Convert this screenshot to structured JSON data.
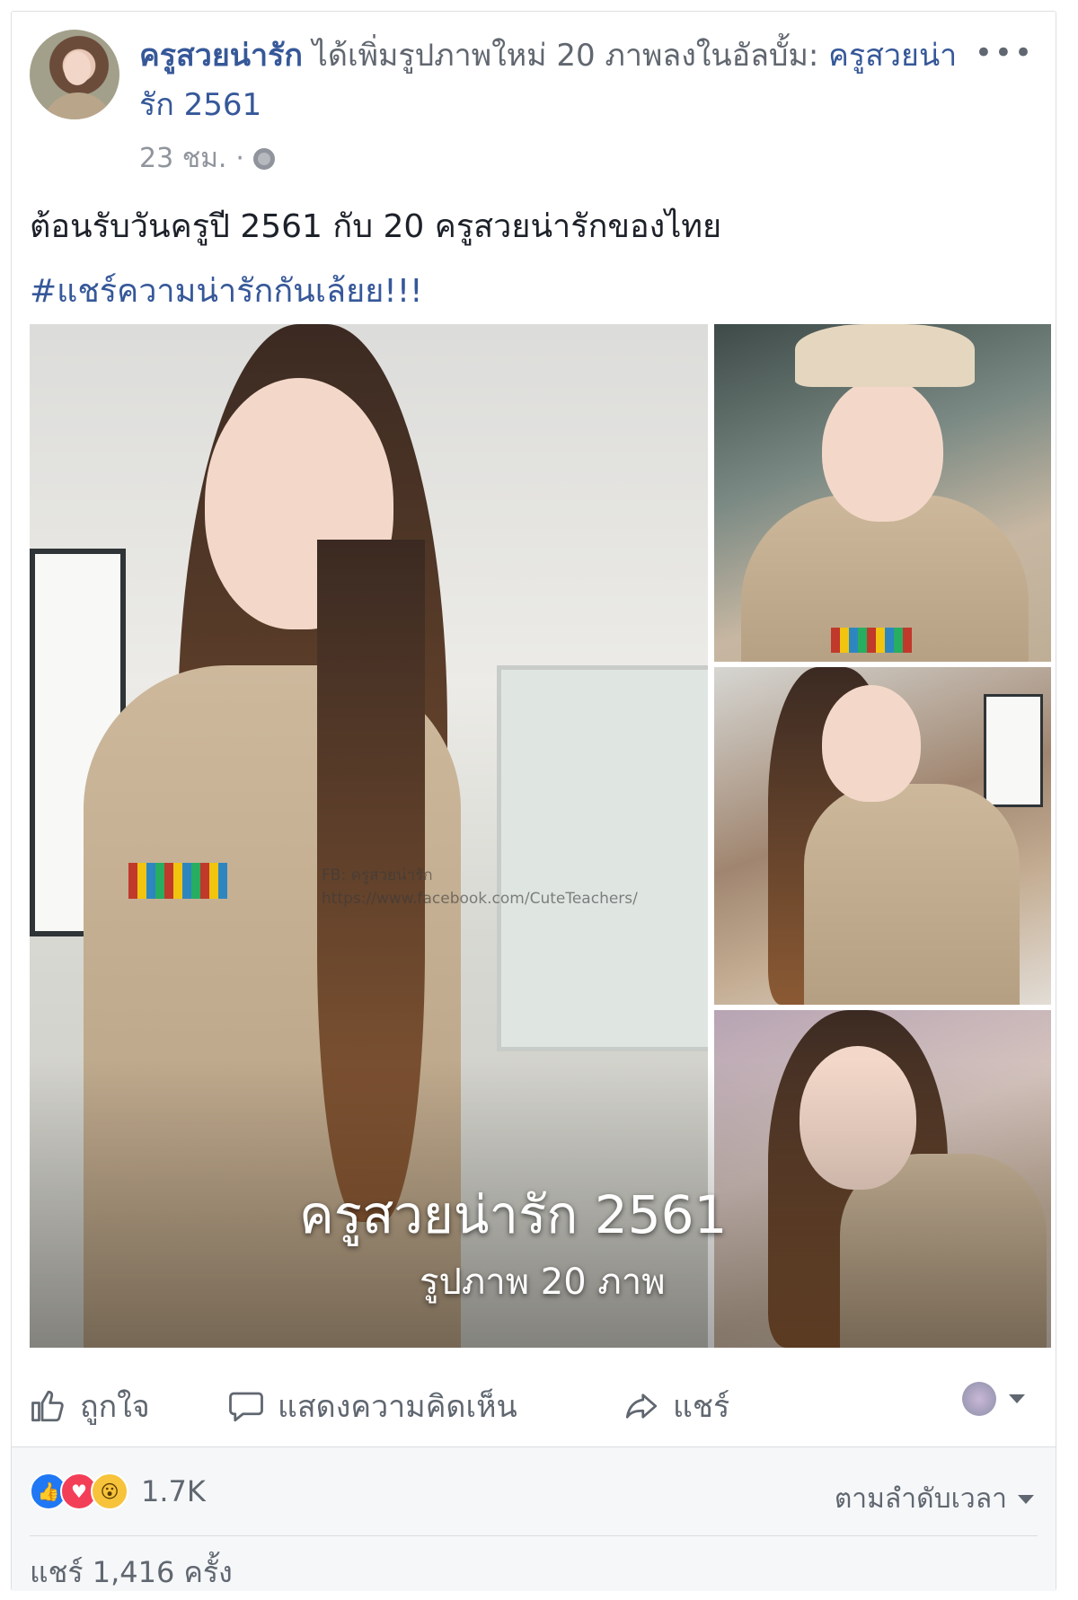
{
  "post": {
    "author": "ครูสวยน่ารัก",
    "action_text": "ได้เพิ่มรูปภาพใหม่ 20 ภาพลงในอัลบั้ม:",
    "album_name": "ครูสวยน่ารัก 2561",
    "timestamp": "23 ชม.",
    "separator": "·",
    "more_label": "•••",
    "text": "ต้อนรับวันครูปี 2561 กับ 20 ครูสวยน่ารักของไทย",
    "hashtag": "#แชร์ความน่ารักกันเล้ยย!!!"
  },
  "album_overlay": {
    "title": "ครูสวยน่ารัก 2561",
    "count": "รูปภาพ 20 ภาพ"
  },
  "watermark": {
    "line1": "FB: ครูสวยน่ารัก",
    "line2": "https://www.facebook.com/CuteTeachers/"
  },
  "actions": {
    "like": "ถูกใจ",
    "comment": "แสดงความคิดเห็น",
    "share": "แชร์"
  },
  "footer": {
    "reaction_count": "1.7K",
    "sort_label": "ตามลำดับเวลา",
    "shares": "แชร์ 1,416 ครั้ง"
  },
  "icons": [
    "globe-icon",
    "more-icon",
    "like-icon",
    "comment-icon",
    "share-icon",
    "audience-avatar",
    "caret-down-icon",
    "like-reaction-icon",
    "love-reaction-icon",
    "wow-reaction-icon"
  ],
  "colors": {
    "link": "#365899",
    "meta": "#90949c",
    "like": "#2078f4",
    "love": "#f33e58",
    "wow": "#f7c33b"
  }
}
